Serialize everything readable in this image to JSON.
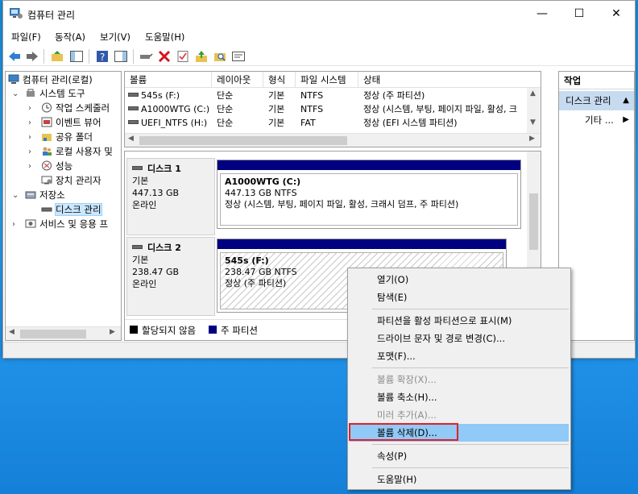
{
  "window": {
    "title": "컴퓨터 관리",
    "minimize": "—",
    "maximize": "☐",
    "close": "✕"
  },
  "menu": [
    "파일(F)",
    "동작(A)",
    "보기(V)",
    "도움말(H)"
  ],
  "tree": {
    "root": "컴퓨터 관리(로컬)",
    "system_tools": "시스템 도구",
    "task_scheduler": "작업 스케줄러",
    "event_viewer": "이벤트 뷰어",
    "shared_folders": "공유 폴더",
    "local_users": "로컬 사용자 및",
    "performance": "성능",
    "device_manager": "장치 관리자",
    "storage": "저장소",
    "disk_management": "디스크 관리",
    "services_apps": "서비스 및 응용 프"
  },
  "volumes": {
    "columns": [
      "볼륨",
      "레이아웃",
      "형식",
      "파일 시스템",
      "상태"
    ],
    "rows": [
      {
        "name": "545s (F:)",
        "layout": "단순",
        "type": "기본",
        "fs": "NTFS",
        "status": "정상 (주 파티션)"
      },
      {
        "name": "A1000WTG (C:)",
        "layout": "단순",
        "type": "기본",
        "fs": "NTFS",
        "status": "정상 (시스템, 부팅, 페이지 파일, 활성, 크"
      },
      {
        "name": "UEFI_NTFS (H:)",
        "layout": "단순",
        "type": "기본",
        "fs": "FAT",
        "status": "정상 (EFI 시스템 파티션)"
      }
    ]
  },
  "disks": [
    {
      "name": "디스크 1",
      "kind": "기본",
      "size": "447.13 GB",
      "state": "온라인",
      "partition": {
        "label": "A1000WTG  (C:)",
        "size": "447.13 GB NTFS",
        "status": "정상 (시스템, 부팅, 페이지 파일, 활성, 크래시 덤프, 주 파티션)"
      }
    },
    {
      "name": "디스크 2",
      "kind": "기본",
      "size": "238.47 GB",
      "state": "온라인",
      "partition": {
        "label": "545s  (F:)",
        "size": "238.47 GB NTFS",
        "status": "정상 (주 파티션)"
      }
    }
  ],
  "legend": {
    "unallocated": "할당되지 않음",
    "primary": "주 파티션",
    "unallocated_color": "#000000",
    "primary_color": "#000080"
  },
  "actions": {
    "header": "작업",
    "selected": "디스크 관리",
    "more": "기타 ..."
  },
  "context_menu": {
    "open": "열기(O)",
    "explore": "탐색(E)",
    "mark_active": "파티션을 활성 파티션으로 표시(M)",
    "change_letter": "드라이브 문자 및 경로 변경(C)...",
    "format": "포맷(F)...",
    "extend": "볼륨 확장(X)...",
    "shrink": "볼륨 축소(H)...",
    "add_mirror": "미러 추가(A)...",
    "delete": "볼륨 삭제(D)...",
    "properties": "속성(P)",
    "help": "도움말(H)"
  },
  "colors": {
    "selection": "#91c9f7",
    "highlight_box": "#e0202a",
    "disk_bar": "#000080"
  }
}
